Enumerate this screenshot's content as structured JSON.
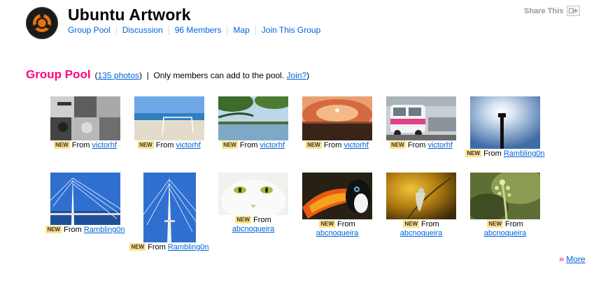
{
  "group": {
    "title": "Ubuntu Artwork",
    "nav": [
      "Group Pool",
      "Discussion",
      "96 Members",
      "Map",
      "Join This Group"
    ]
  },
  "share": {
    "label": "Share This",
    "icon": "share-icon"
  },
  "pool": {
    "title": "Group Pool",
    "photos_link": "135 photos",
    "separator": "|",
    "notice": "Only members can add to the pool.",
    "join_link": "Join?"
  },
  "badge": "NEW",
  "from_label": "From",
  "photos": [
    {
      "user": "victorhf",
      "subject": "beatles-collage"
    },
    {
      "user": "victorhf",
      "subject": "beach-goal"
    },
    {
      "user": "victorhf",
      "subject": "lake-trees"
    },
    {
      "user": "victorhf",
      "subject": "sunset"
    },
    {
      "user": "victorhf",
      "subject": "pink-van"
    },
    {
      "user": "Rambling0n",
      "subject": "sun-tower"
    },
    {
      "user": "Rambling0n",
      "subject": "bridge-pylon"
    },
    {
      "user": "Rambling0n",
      "subject": "bridge-pylon-tall"
    },
    {
      "user": "abcnoqueira",
      "subject": "white-cat"
    },
    {
      "user": "abcnoqueira",
      "subject": "toucan"
    },
    {
      "user": "abcnoqueira",
      "subject": "lizard-branch"
    },
    {
      "user": "abcnoqueira",
      "subject": "green-bud"
    }
  ],
  "more_label": "More",
  "colors": {
    "accent_pink": "#ff0084",
    "link_blue": "#0063dc",
    "badge_yellow": "#ffe28a"
  }
}
